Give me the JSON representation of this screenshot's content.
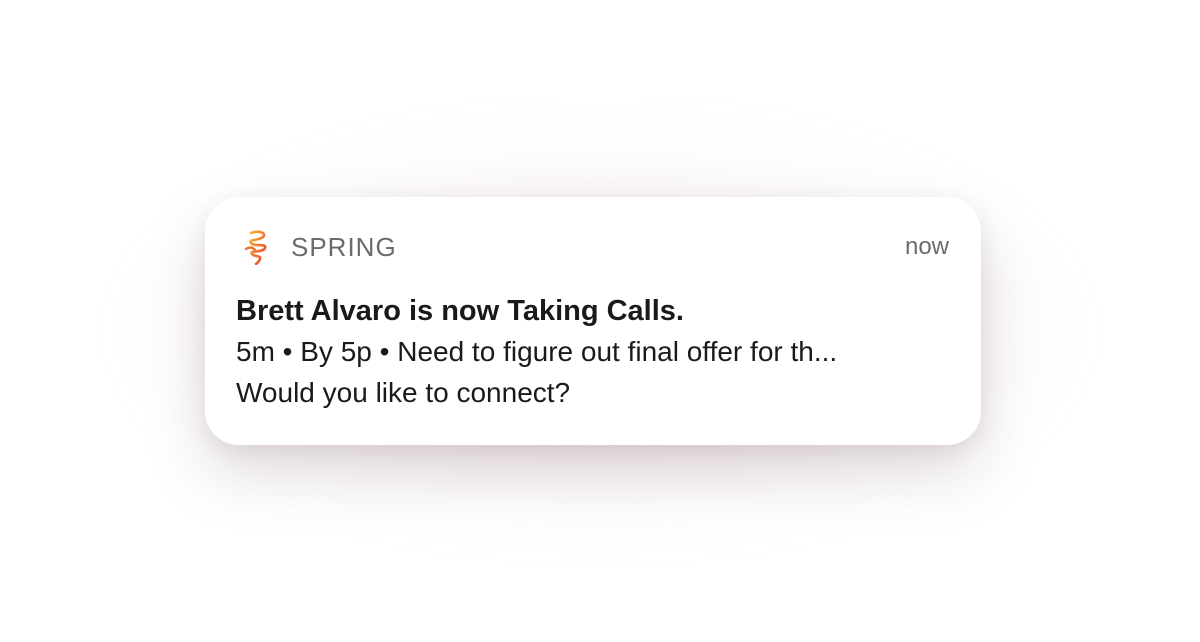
{
  "notification": {
    "app_name": "SPRING",
    "app_icon": "spring-logo-icon",
    "timestamp": "now",
    "title": "Brett Alvaro is now Taking Calls.",
    "body_line_1": "5m • By 5p • Need to figure out final offer for th...",
    "body_line_2": "Would you like to connect?"
  },
  "colors": {
    "logo_orange": "#f39a2e",
    "logo_red": "#e8402f",
    "secondary_text": "#6b6b6b",
    "primary_text": "#1a1a1a"
  }
}
